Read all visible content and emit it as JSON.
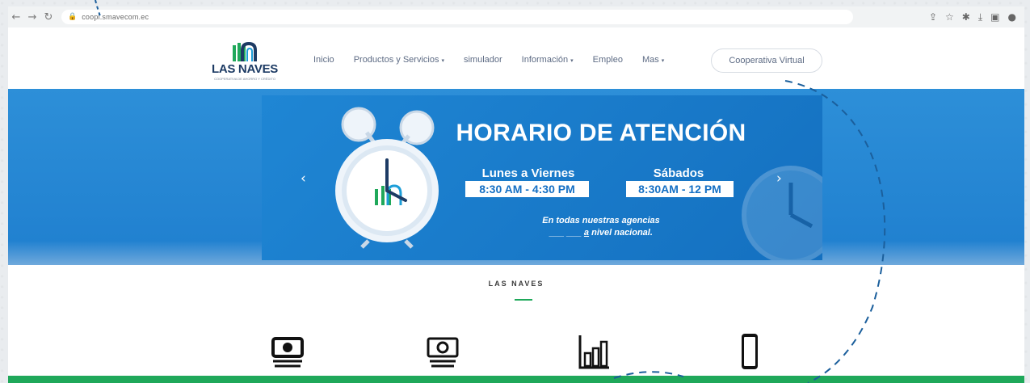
{
  "browser": {
    "url": "coopl.smavecom.ec",
    "icons": [
      "share-icon",
      "star-icon",
      "puzzle-icon",
      "download-icon",
      "sidebar-icon",
      "profile-icon"
    ]
  },
  "site": {
    "logo_name": "LAS NAVES",
    "logo_tagline": "COOPERATIVA DE AHORRO Y CRÉDITO",
    "nav": [
      {
        "label": "Inicio",
        "dropdown": false
      },
      {
        "label": "Productos y Servicios",
        "dropdown": true
      },
      {
        "label": "simulador",
        "dropdown": false
      },
      {
        "label": "Información",
        "dropdown": true
      },
      {
        "label": "Empleo",
        "dropdown": false
      },
      {
        "label": "Mas",
        "dropdown": true
      }
    ],
    "cta_label": "Cooperativa Virtual"
  },
  "banner": {
    "title": "HORARIO DE ATENCIÓN",
    "weekday_label": "Lunes a Viernes",
    "weekday_hours": "8:30 AM - 4:30 PM",
    "saturday_label": "Sábados",
    "saturday_hours": "8:30AM - 12 PM",
    "note_line1": "En todas nuestras agencias",
    "note_line2_prefix": "___ ___",
    "note_line2_under": "a",
    "note_line2_suffix": " nivel nacional."
  },
  "section": {
    "title": "LAS NAVES",
    "features": [
      "money-stack-icon",
      "cash-icon",
      "bar-chart-icon",
      "smartphone-icon"
    ]
  },
  "colors": {
    "brand_blue": "#1f7fcf",
    "brand_green": "#1fa85a",
    "logo_navy": "#1d3b64"
  }
}
